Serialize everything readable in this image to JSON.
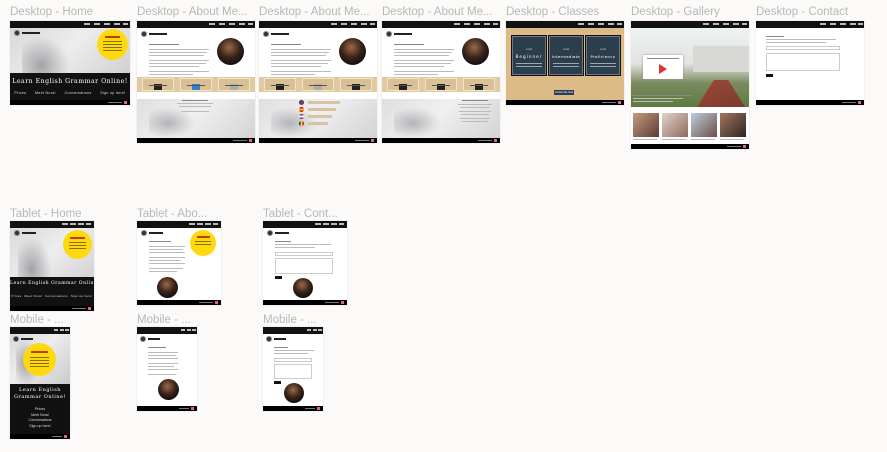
{
  "canvas": {
    "labels": {
      "d_home": "Desktop - Home",
      "d_about1": "Desktop - About Me...",
      "d_about2": "Desktop - About Me...",
      "d_about3": "Desktop - About Me...",
      "d_classes": "Desktop - Classes",
      "d_gallery": "Desktop - Gallery",
      "d_contact": "Desktop - Contact",
      "t_home": "Tablet - Home",
      "t_about": "Tablet - Abo...",
      "t_contact": "Tablet - Cont...",
      "m_home": "Mobile - ...",
      "m_about": "Mobile - ...",
      "m_contact": "Mobile - ..."
    }
  },
  "site": {
    "hero_title": "Learn English Grammar Online!",
    "hero_title_mobile_line1": "Learn English",
    "hero_title_mobile_line2": "Grammar Online!",
    "nav_links": [
      "Prices",
      "Meet Nora!",
      "Conversations",
      "Sign up here!"
    ],
    "class_levels": [
      {
        "level": "Beginner",
        "sub": "Level"
      },
      {
        "level": "Intermediate",
        "sub": "Level"
      },
      {
        "level": "Proficiency",
        "sub": "Level"
      }
    ],
    "contact_button": "Contact Me Now"
  },
  "colors": {
    "accent_yellow": "#ffd90f",
    "beige": "#e0caa2",
    "dark": "#111111",
    "footer_pink": "#e85ca3",
    "card_navy": "#2c3d4d"
  }
}
